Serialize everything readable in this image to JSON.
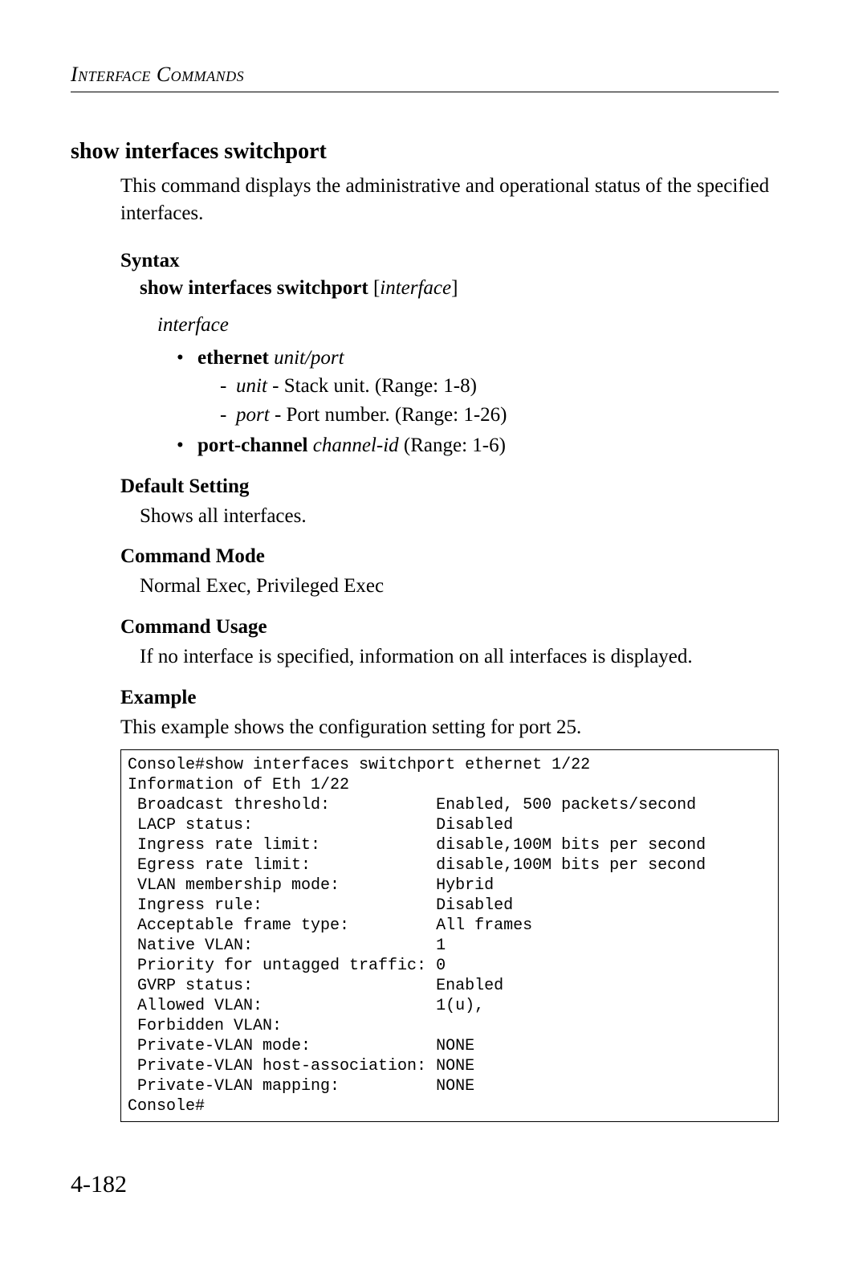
{
  "header": {
    "running_title": "Interface Commands"
  },
  "section": {
    "title": "show interfaces switchport",
    "description": "This command displays the administrative and operational status of the specified interfaces.",
    "syntax_label": "Syntax",
    "syntax_cmd_bold": "show interfaces switchport",
    "syntax_bracket_open": " [",
    "syntax_param": "interface",
    "syntax_bracket_close": "]",
    "interface_param": "interface",
    "bullets": {
      "ethernet": {
        "kw": "ethernet",
        "args": "unit/port",
        "unit_name": "unit",
        "unit_text": " - Stack unit. (Range: 1-8)",
        "port_name": "port",
        "port_text": " - Port number. (Range: 1-26)"
      },
      "port_channel": {
        "kw": "port-channel",
        "arg": "channel-id",
        "tail": " (Range: 1-6)"
      }
    },
    "default_label": "Default Setting",
    "default_text": "Shows all interfaces.",
    "mode_label": "Command Mode",
    "mode_text": "Normal Exec, Privileged Exec",
    "usage_label": "Command Usage",
    "usage_text": "If no interface is specified, information on all interfaces is displayed.",
    "example_label": "Example",
    "example_intro": "This example shows the configuration setting for port 25.",
    "example_code": "Console#show interfaces switchport ethernet 1/22\nInformation of Eth 1/22\n Broadcast threshold:           Enabled, 500 packets/second\n LACP status:                   Disabled\n Ingress rate limit:            disable,100M bits per second\n Egress rate limit:             disable,100M bits per second\n VLAN membership mode:          Hybrid\n Ingress rule:                  Disabled\n Acceptable frame type:         All frames\n Native VLAN:                   1\n Priority for untagged traffic: 0\n GVRP status:                   Enabled\n Allowed VLAN:                  1(u),\n Forbidden VLAN:\n Private-VLAN mode:             NONE\n Private-VLAN host-association: NONE\n Private-VLAN mapping:          NONE\nConsole#"
  },
  "footer": {
    "page_number": "4-182"
  }
}
